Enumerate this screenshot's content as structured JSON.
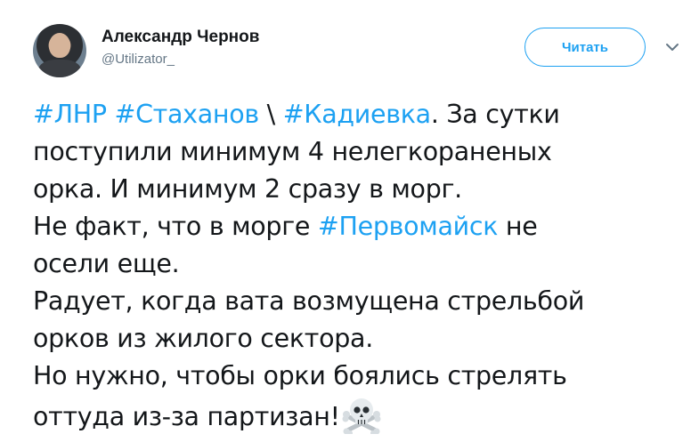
{
  "author": {
    "display_name": "Александр Чернов",
    "username": "@Utilizator_"
  },
  "actions": {
    "follow_label": "Читать",
    "caret_icon": "chevron-down-icon"
  },
  "tweet": {
    "lines": [
      [
        {
          "text": "#ЛНР",
          "hashtag": true
        },
        {
          "text": " ",
          "hashtag": false
        },
        {
          "text": "#Стаханов",
          "hashtag": true
        },
        {
          "text": " \\ ",
          "hashtag": false
        },
        {
          "text": "#Кадиевка",
          "hashtag": true
        },
        {
          "text": ". За сутки",
          "hashtag": false
        }
      ],
      [
        {
          "text": "поступили минимум 4 нелегкораненых",
          "hashtag": false
        }
      ],
      [
        {
          "text": "орка. И минимум 2 сразу в морг.",
          "hashtag": false
        }
      ],
      [
        {
          "text": "Не факт, что в морге ",
          "hashtag": false
        },
        {
          "text": "#Первомайск",
          "hashtag": true
        },
        {
          "text": " не",
          "hashtag": false
        }
      ],
      [
        {
          "text": "осели еще.",
          "hashtag": false
        }
      ],
      [
        {
          "text": "Радует, когда вата возмущена стрельбой",
          "hashtag": false
        }
      ],
      [
        {
          "text": "орков из жилого сектора.",
          "hashtag": false
        }
      ],
      [
        {
          "text": "Но нужно, чтобы орки боялись стрелять",
          "hashtag": false
        }
      ],
      [
        {
          "text": "оттуда из-за партизан!",
          "hashtag": false
        }
      ]
    ],
    "emoji": "skull-and-crossbones-icon"
  },
  "colors": {
    "accent": "#1da1f2",
    "text": "#14171a",
    "secondary": "#657786"
  }
}
